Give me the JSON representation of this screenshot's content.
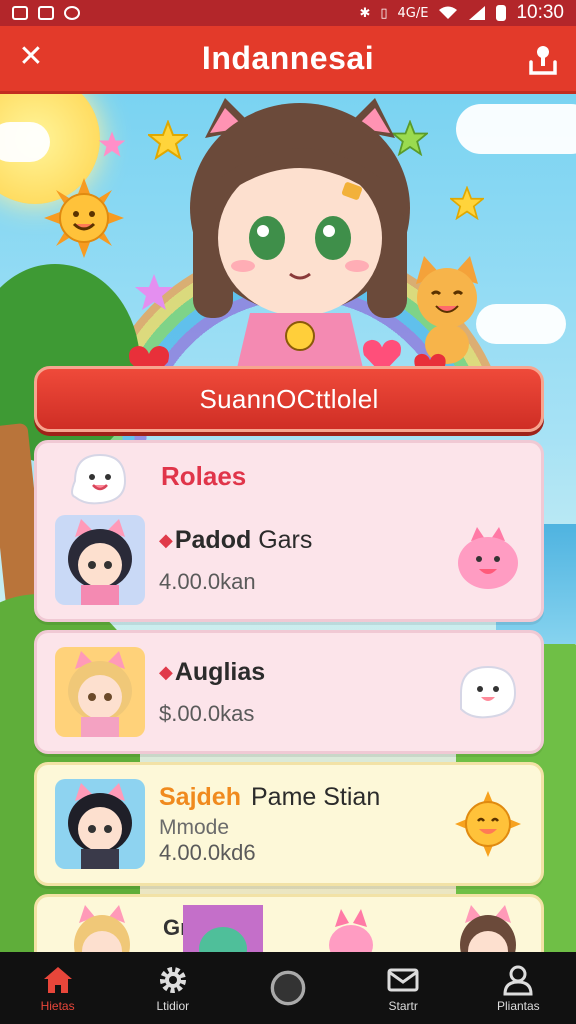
{
  "status_bar": {
    "time": "10:30",
    "network_label": "4G/E"
  },
  "header": {
    "title": "Indannesai"
  },
  "hero": {
    "ribbon_text": "SuannOCttlolel"
  },
  "list": {
    "section_header": "Rolaes",
    "items": [
      {
        "name_bold": "Padod",
        "name_rest": "Gars",
        "detail": "4.00.0kan",
        "style": "pink"
      },
      {
        "name_bold": "Auglias",
        "name_rest": "",
        "detail": "$.00.0kas",
        "style": "pink"
      },
      {
        "name_bold": "Sajdeh",
        "name_rest": "Pame Stian",
        "subtitle": "Mmode",
        "detail": "4.00.0kd6",
        "style": "cream"
      }
    ],
    "peek_text": "Grr"
  },
  "bottom_nav": [
    {
      "label": "Hietas",
      "icon": "home-icon",
      "active": true
    },
    {
      "label": "Ltidior",
      "icon": "gear-icon",
      "active": false
    },
    {
      "label": "",
      "icon": "circle-icon",
      "active": false
    },
    {
      "label": "Startr",
      "icon": "mail-icon",
      "active": false
    },
    {
      "label": "Pliantas",
      "icon": "user-icon",
      "active": false
    }
  ],
  "colors": {
    "header_red": "#e33a2a",
    "status_red": "#b3262a",
    "card_pink": "#fce4ea",
    "card_cream": "#fdf8d8",
    "accent_red_text": "#e0354a",
    "accent_orange_text": "#f08a1e",
    "nav_active": "#e8463a"
  }
}
